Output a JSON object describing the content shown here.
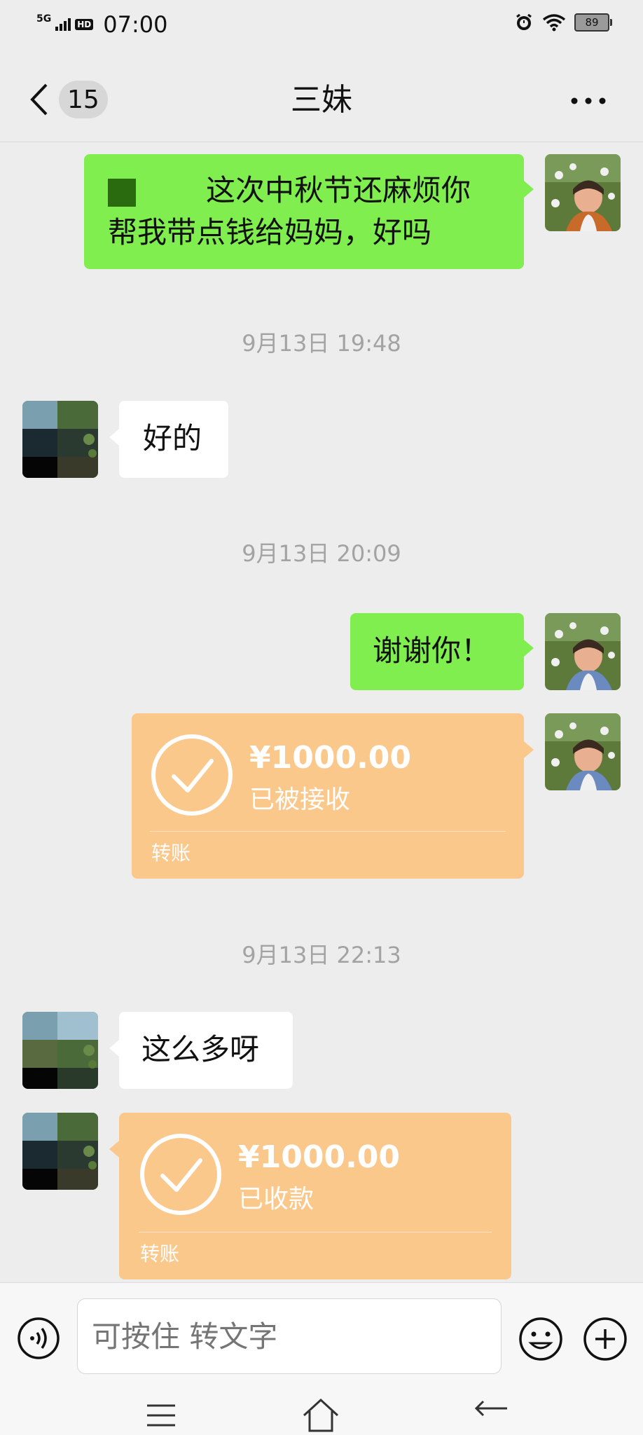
{
  "status_bar": {
    "network": "5G",
    "hd": "HD",
    "time": "07:00",
    "battery": "89"
  },
  "nav": {
    "back_count": "15",
    "title": "三妹"
  },
  "messages": {
    "m1": {
      "text_line1": "这次中秋节还麻烦你",
      "text_line2": "帮我带点钱给妈妈，好吗"
    },
    "t1": "9月13日 19:48",
    "m2": {
      "text": "好的"
    },
    "t2": "9月13日 20:09",
    "m3": {
      "text": "谢谢你！"
    },
    "transfer1": {
      "amount": "¥1000.00",
      "status": "已被接收",
      "label": "转账"
    },
    "t3": "9月13日 22:13",
    "m4": {
      "text": "这么多呀"
    },
    "transfer2": {
      "amount": "¥1000.00",
      "status": "已收款",
      "label": "转账"
    }
  },
  "input": {
    "placeholder": "可按住 转文字"
  },
  "colors": {
    "sent_bubble": "#7fee4e",
    "transfer_bubble": "#fbc88c",
    "background": "#ededed"
  }
}
